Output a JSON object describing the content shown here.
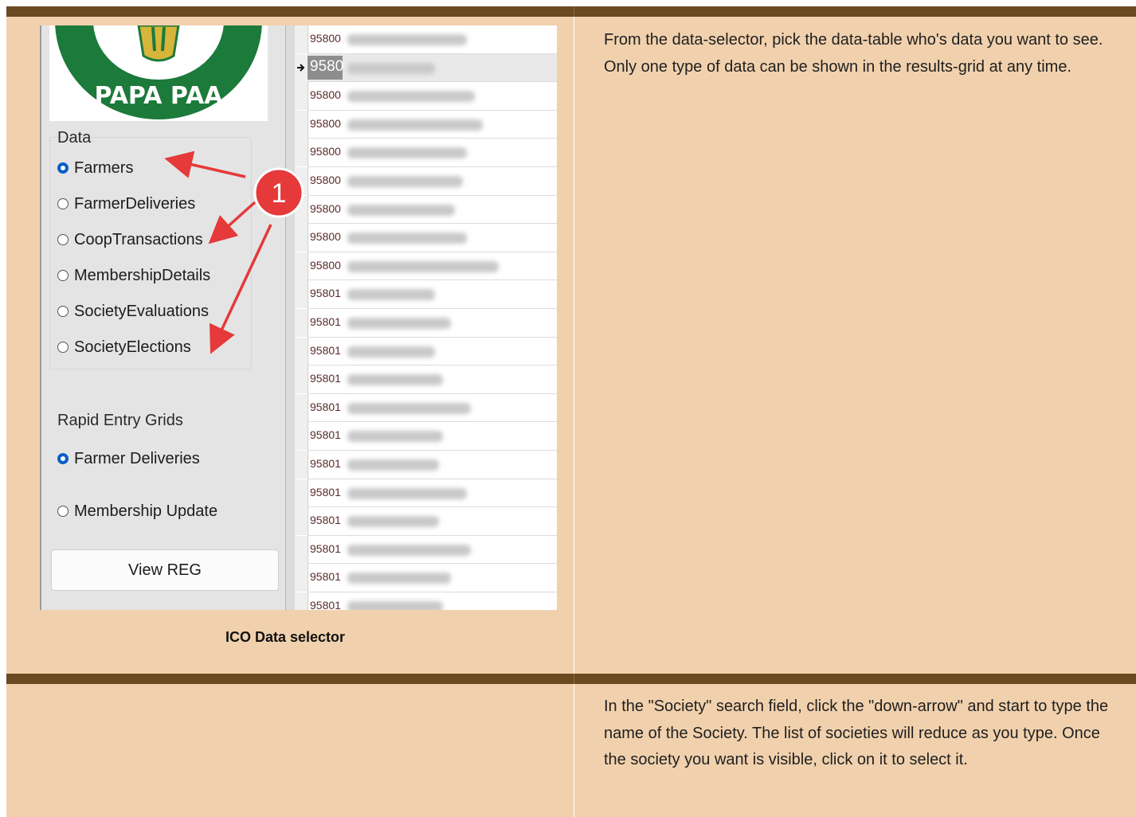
{
  "doc": {
    "row1_text": "From the data-selector, pick the data-table who's data you want to see. Only one type of data can be shown in the results-grid at any time.",
    "row2_text": "In the \"Society\" search field, click the \"down-arrow\" and start to type the name of the Society. The list of societies will reduce as you type. Once the society you want is visible, click on it to select it.",
    "caption": "ICO Data selector"
  },
  "logo": {
    "text": "PAPA PAA"
  },
  "sidebar": {
    "data_title": "Data",
    "data_options": [
      {
        "label": "Farmers",
        "selected": true
      },
      {
        "label": "FarmerDeliveries",
        "selected": false
      },
      {
        "label": "CoopTransactions",
        "selected": false
      },
      {
        "label": "MembershipDetails",
        "selected": false
      },
      {
        "label": "SocietyEvaluations",
        "selected": false
      },
      {
        "label": "SocietyElections",
        "selected": false
      }
    ],
    "rapid_title": "Rapid Entry Grids",
    "rapid_options": [
      {
        "label": "Farmer Deliveries",
        "selected": true
      },
      {
        "label": "Membership Update",
        "selected": false
      }
    ],
    "view_button": "View REG"
  },
  "callout": {
    "number": "1"
  },
  "grid": {
    "rows": [
      {
        "id": "95800"
      },
      {
        "id": "9580",
        "selected": true
      },
      {
        "id": "95800"
      },
      {
        "id": "95800"
      },
      {
        "id": "95800"
      },
      {
        "id": "95800"
      },
      {
        "id": "95800"
      },
      {
        "id": "95800"
      },
      {
        "id": "95800"
      },
      {
        "id": "95801"
      },
      {
        "id": "95801"
      },
      {
        "id": "95801"
      },
      {
        "id": "95801"
      },
      {
        "id": "95801"
      },
      {
        "id": "95801"
      },
      {
        "id": "95801"
      },
      {
        "id": "95801"
      },
      {
        "id": "95801"
      },
      {
        "id": "95801"
      },
      {
        "id": "95801"
      },
      {
        "id": "95801"
      }
    ]
  },
  "colors": {
    "band": "#6b4a22",
    "cell": "#f1d1ad",
    "radio_selected": "#0a5fc8",
    "callout": "#e5393a",
    "logo_green": "#1c7a3a"
  }
}
